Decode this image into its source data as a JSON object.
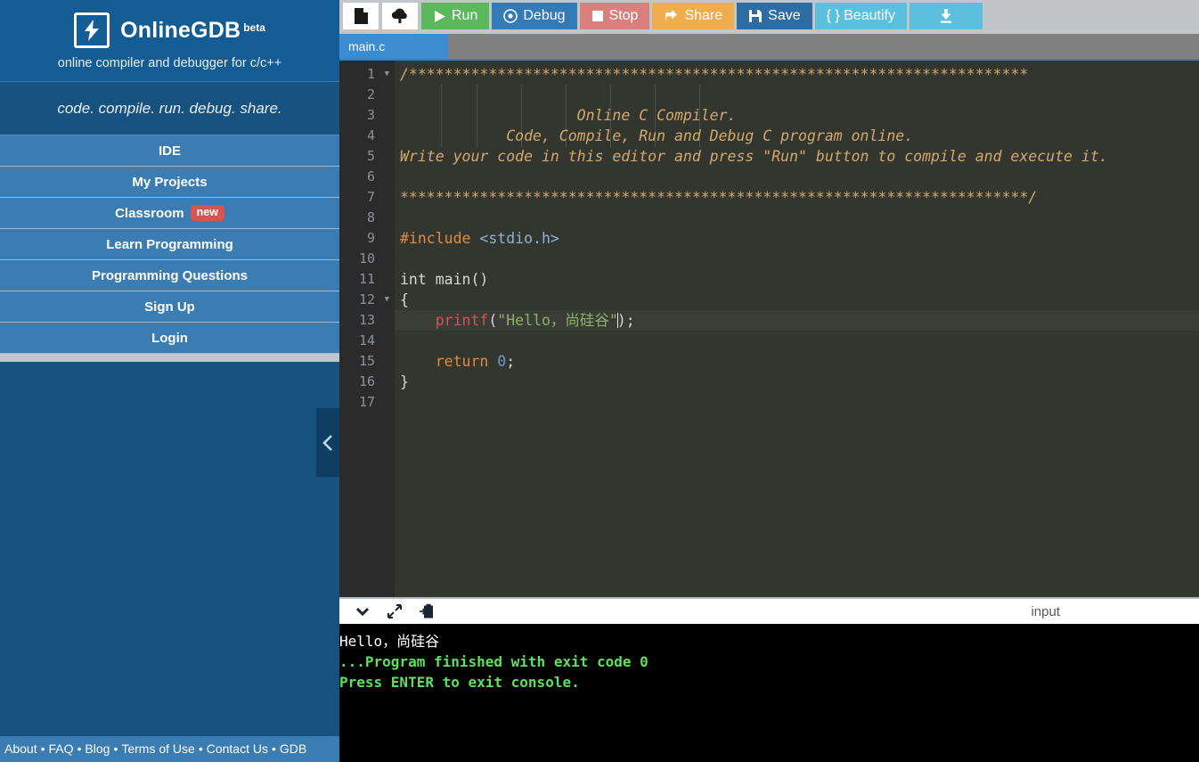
{
  "sidebar": {
    "brand": {
      "name": "OnlineGDB",
      "beta": "beta",
      "tagline": "online compiler and debugger for c/c++",
      "logo_icon": "lightning-bolt-icon"
    },
    "slogan": "code. compile. run. debug. share.",
    "nav_items": [
      {
        "label": "IDE",
        "badge": ""
      },
      {
        "label": "My Projects",
        "badge": ""
      },
      {
        "label": "Classroom",
        "badge": "new"
      },
      {
        "label": "Learn Programming",
        "badge": ""
      },
      {
        "label": "Programming Questions",
        "badge": ""
      },
      {
        "label": "Sign Up",
        "badge": ""
      },
      {
        "label": "Login",
        "badge": ""
      }
    ],
    "collapse_icon": "chevron-left-icon",
    "footer_links": [
      "About",
      "FAQ",
      "Blog",
      "Terms of Use",
      "Contact Us",
      "GDB"
    ],
    "footer_separator": "•"
  },
  "toolbar": {
    "new_file_icon": "new-file-icon",
    "upload_icon": "cloud-upload-icon",
    "run_label": "Run",
    "run_icon": "play-icon",
    "debug_label": "Debug",
    "debug_icon": "debug-circle-icon",
    "stop_label": "Stop",
    "stop_icon": "stop-square-icon",
    "share_label": "Share",
    "share_icon": "share-icon",
    "save_label": "Save",
    "save_icon": "floppy-disk-icon",
    "beautify_label": "{ } Beautify",
    "download_icon": "download-icon",
    "colors": {
      "run": "#5cb85c",
      "debug": "#337ab7",
      "stop": "#d9807f",
      "share": "#efad4e",
      "save": "#2e6da4",
      "beautify": "#5bc0de"
    }
  },
  "editor": {
    "tab_name": "main.c",
    "line_numbers": [
      "1",
      "2",
      "3",
      "4",
      "5",
      "6",
      "7",
      "8",
      "9",
      "10",
      "11",
      "12",
      "13",
      "14",
      "15",
      "16",
      "17"
    ],
    "active_line": 13,
    "code_lines": [
      "/**********************************************************************",
      "",
      "                    Online C Compiler.",
      "            Code, Compile, Run and Debug C program online.",
      "Write your code in this editor and press \"Run\" button to compile and execute it.",
      "",
      "***********************************************************************/",
      "",
      "#include <stdio.h>",
      "",
      "int main()",
      "{",
      "    printf(\"Hello，尚硅谷\");",
      "",
      "    return 0;",
      "}",
      ""
    ],
    "code_tokens": {
      "include_directive": "#include",
      "header": "<stdio.h>",
      "main_signature": "int main()",
      "open_brace": "{",
      "printf_name": "printf",
      "printf_string": "\"Hello，尚硅谷\"",
      "return_keyword": "return",
      "return_value": "0",
      "close_brace": "}"
    }
  },
  "console": {
    "collapse_icon": "chevron-down-icon",
    "fullscreen_icon": "expand-arrows-icon",
    "paste_icon": "paste-clipboard-icon",
    "input_label": "input",
    "output_lines": [
      {
        "text": "Hello，尚硅谷",
        "style": "white"
      },
      {
        "text": "",
        "style": "white"
      },
      {
        "text": "...Program finished with exit code 0",
        "style": "green"
      },
      {
        "text": "Press ENTER to exit console.",
        "style": "green"
      }
    ]
  }
}
